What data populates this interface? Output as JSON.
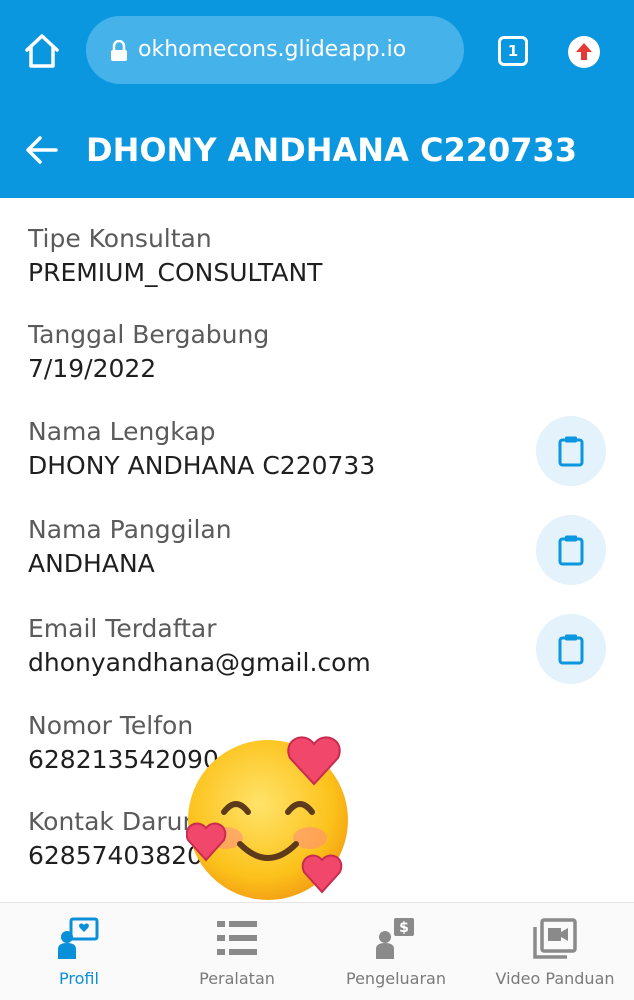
{
  "browser": {
    "url": "okhomecons.glideapp.io",
    "tab_count": "1"
  },
  "header": {
    "title": "DHONY ANDHANA C220733"
  },
  "fields": [
    {
      "label": "Tipe Konsultan",
      "value": "PREMIUM_CONSULTANT",
      "copyable": false
    },
    {
      "label": "Tanggal Bergabung",
      "value": "7/19/2022",
      "copyable": false
    },
    {
      "label": "Nama Lengkap",
      "value": "DHONY ANDHANA C220733",
      "copyable": true
    },
    {
      "label": "Nama Panggilan",
      "value": "ANDHANA",
      "copyable": true
    },
    {
      "label": "Email Terdaftar",
      "value": "dhonyandhana@gmail.com",
      "copyable": true
    },
    {
      "label": "Nomor Telfon",
      "value": "628213542090",
      "copyable": false
    },
    {
      "label": "Kontak Darurat",
      "value": "628574038200",
      "copyable": false
    }
  ],
  "nav": [
    {
      "label": "Profil",
      "icon": "profile-chat-icon",
      "active": true
    },
    {
      "label": "Peralatan",
      "icon": "list-icon",
      "active": false
    },
    {
      "label": "Pengeluaran",
      "icon": "expense-icon",
      "active": false
    },
    {
      "label": "Video Panduan",
      "icon": "video-library-icon",
      "active": false
    }
  ],
  "colors": {
    "primary": "#0a97df",
    "active_nav": "#0a8fd9",
    "copy_bg": "#e3f2fb"
  }
}
